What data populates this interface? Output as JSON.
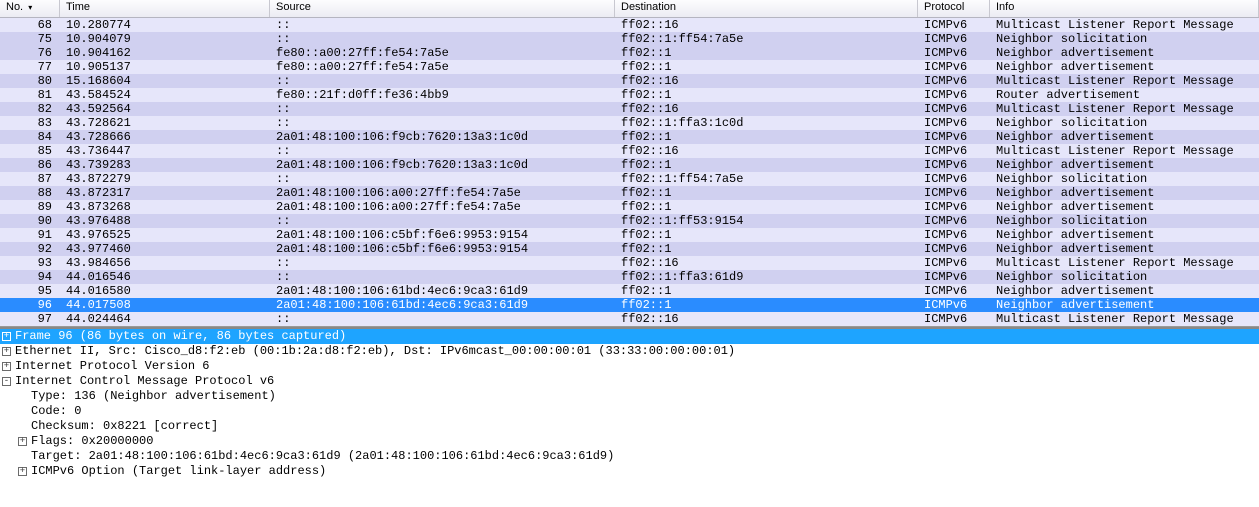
{
  "columns": {
    "no": "No.",
    "time": "Time",
    "source": "Source",
    "destination": "Destination",
    "protocol": "Protocol",
    "info": "Info",
    "sort": "▾"
  },
  "selected_index": 22,
  "packets": [
    {
      "no": "68",
      "time": "10.280774",
      "src": "::",
      "dst": "ff02::16",
      "proto": "ICMPv6",
      "info": "Multicast Listener Report Message",
      "shade": "a"
    },
    {
      "no": "75",
      "time": "10.904079",
      "src": "::",
      "dst": "ff02::1:ff54:7a5e",
      "proto": "ICMPv6",
      "info": "Neighbor solicitation",
      "shade": "b"
    },
    {
      "no": "76",
      "time": "10.904162",
      "src": "fe80::a00:27ff:fe54:7a5e",
      "dst": "ff02::1",
      "proto": "ICMPv6",
      "info": "Neighbor advertisement",
      "shade": "b"
    },
    {
      "no": "77",
      "time": "10.905137",
      "src": "fe80::a00:27ff:fe54:7a5e",
      "dst": "ff02::1",
      "proto": "ICMPv6",
      "info": "Neighbor advertisement",
      "shade": "a"
    },
    {
      "no": "80",
      "time": "15.168604",
      "src": "::",
      "dst": "ff02::16",
      "proto": "ICMPv6",
      "info": "Multicast Listener Report Message",
      "shade": "b"
    },
    {
      "no": "81",
      "time": "43.584524",
      "src": "fe80::21f:d0ff:fe36:4bb9",
      "dst": "ff02::1",
      "proto": "ICMPv6",
      "info": "Router advertisement",
      "shade": "a"
    },
    {
      "no": "82",
      "time": "43.592564",
      "src": "::",
      "dst": "ff02::16",
      "proto": "ICMPv6",
      "info": "Multicast Listener Report Message",
      "shade": "b"
    },
    {
      "no": "83",
      "time": "43.728621",
      "src": "::",
      "dst": "ff02::1:ffa3:1c0d",
      "proto": "ICMPv6",
      "info": "Neighbor solicitation",
      "shade": "a"
    },
    {
      "no": "84",
      "time": "43.728666",
      "src": "2a01:48:100:106:f9cb:7620:13a3:1c0d",
      "dst": "ff02::1",
      "proto": "ICMPv6",
      "info": "Neighbor advertisement",
      "shade": "b"
    },
    {
      "no": "85",
      "time": "43.736447",
      "src": "::",
      "dst": "ff02::16",
      "proto": "ICMPv6",
      "info": "Multicast Listener Report Message",
      "shade": "a"
    },
    {
      "no": "86",
      "time": "43.739283",
      "src": "2a01:48:100:106:f9cb:7620:13a3:1c0d",
      "dst": "ff02::1",
      "proto": "ICMPv6",
      "info": "Neighbor advertisement",
      "shade": "b"
    },
    {
      "no": "87",
      "time": "43.872279",
      "src": "::",
      "dst": "ff02::1:ff54:7a5e",
      "proto": "ICMPv6",
      "info": "Neighbor solicitation",
      "shade": "a"
    },
    {
      "no": "88",
      "time": "43.872317",
      "src": "2a01:48:100:106:a00:27ff:fe54:7a5e",
      "dst": "ff02::1",
      "proto": "ICMPv6",
      "info": "Neighbor advertisement",
      "shade": "b"
    },
    {
      "no": "89",
      "time": "43.873268",
      "src": "2a01:48:100:106:a00:27ff:fe54:7a5e",
      "dst": "ff02::1",
      "proto": "ICMPv6",
      "info": "Neighbor advertisement",
      "shade": "a"
    },
    {
      "no": "90",
      "time": "43.976488",
      "src": "::",
      "dst": "ff02::1:ff53:9154",
      "proto": "ICMPv6",
      "info": "Neighbor solicitation",
      "shade": "b"
    },
    {
      "no": "91",
      "time": "43.976525",
      "src": "2a01:48:100:106:c5bf:f6e6:9953:9154",
      "dst": "ff02::1",
      "proto": "ICMPv6",
      "info": "Neighbor advertisement",
      "shade": "a"
    },
    {
      "no": "92",
      "time": "43.977460",
      "src": "2a01:48:100:106:c5bf:f6e6:9953:9154",
      "dst": "ff02::1",
      "proto": "ICMPv6",
      "info": "Neighbor advertisement",
      "shade": "b"
    },
    {
      "no": "93",
      "time": "43.984656",
      "src": "::",
      "dst": "ff02::16",
      "proto": "ICMPv6",
      "info": "Multicast Listener Report Message",
      "shade": "a"
    },
    {
      "no": "94",
      "time": "44.016546",
      "src": "::",
      "dst": "ff02::1:ffa3:61d9",
      "proto": "ICMPv6",
      "info": "Neighbor solicitation",
      "shade": "b"
    },
    {
      "no": "95",
      "time": "44.016580",
      "src": "2a01:48:100:106:61bd:4ec6:9ca3:61d9",
      "dst": "ff02::1",
      "proto": "ICMPv6",
      "info": "Neighbor advertisement",
      "shade": "a"
    },
    {
      "no": "96",
      "time": "44.017508",
      "src": "2a01:48:100:106:61bd:4ec6:9ca3:61d9",
      "dst": "ff02::1",
      "proto": "ICMPv6",
      "info": "Neighbor advertisement",
      "shade": "sel"
    },
    {
      "no": "97",
      "time": "44.024464",
      "src": "::",
      "dst": "ff02::16",
      "proto": "ICMPv6",
      "info": "Multicast Listener Report Message",
      "shade": "a"
    }
  ],
  "tree": [
    {
      "exp": "+",
      "hl": true,
      "indent": 0,
      "text": "Frame 96 (86 bytes on wire, 86 bytes captured)"
    },
    {
      "exp": "+",
      "hl": false,
      "indent": 0,
      "text": "Ethernet II, Src: Cisco_d8:f2:eb (00:1b:2a:d8:f2:eb), Dst: IPv6mcast_00:00:00:01 (33:33:00:00:00:01)"
    },
    {
      "exp": "+",
      "hl": false,
      "indent": 0,
      "text": "Internet Protocol Version 6"
    },
    {
      "exp": "-",
      "hl": false,
      "indent": 0,
      "text": "Internet Control Message Protocol v6"
    },
    {
      "exp": "",
      "hl": false,
      "indent": 1,
      "text": "Type: 136 (Neighbor advertisement)"
    },
    {
      "exp": "",
      "hl": false,
      "indent": 1,
      "text": "Code: 0"
    },
    {
      "exp": "",
      "hl": false,
      "indent": 1,
      "text": "Checksum: 0x8221 [correct]"
    },
    {
      "exp": "+",
      "hl": false,
      "indent": 1,
      "text": "Flags: 0x20000000"
    },
    {
      "exp": "",
      "hl": false,
      "indent": 1,
      "text": "Target: 2a01:48:100:106:61bd:4ec6:9ca3:61d9 (2a01:48:100:106:61bd:4ec6:9ca3:61d9)"
    },
    {
      "exp": "+",
      "hl": false,
      "indent": 1,
      "text": "ICMPv6 Option (Target link-layer address)"
    }
  ]
}
